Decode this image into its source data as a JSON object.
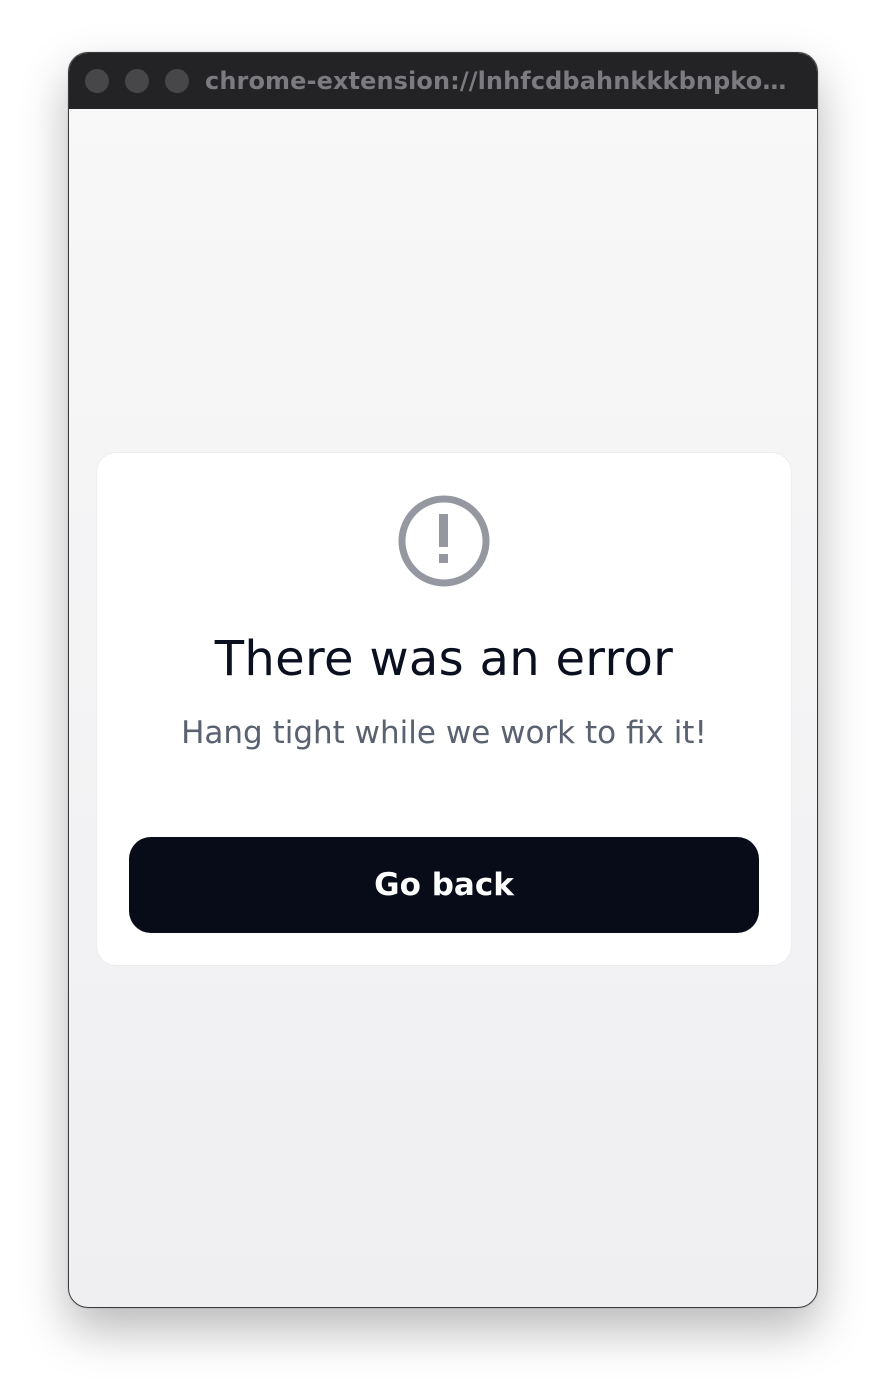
{
  "window": {
    "url": "chrome-extension://lnhfcdbahnkkkbnpkoefp...",
    "controls": [
      "close",
      "minimize",
      "zoom"
    ]
  },
  "error": {
    "icon": "exclamation-circle-icon",
    "title": "There was an error",
    "message": "Hang tight while we work to fix it!",
    "button_label": "Go back"
  },
  "colors": {
    "titlebar": "#232325",
    "button": "#070c18",
    "title_text": "#0b1020",
    "message_text": "#5a6170",
    "icon": "#9597a1"
  }
}
